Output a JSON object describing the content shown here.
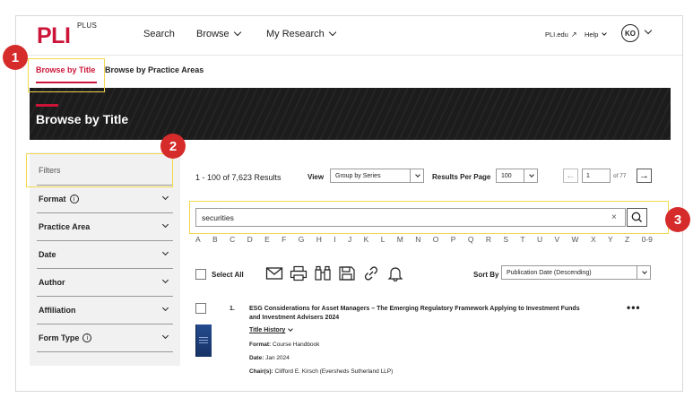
{
  "header": {
    "logo": "PLI",
    "logo_sup": "PLUS",
    "nav": {
      "search": "Search",
      "browse": "Browse",
      "my_research": "My Research"
    },
    "pli_edu": "PLI.edu",
    "help": "Help",
    "avatar_initials": "KO"
  },
  "subtabs": {
    "browse_by_title": "Browse by Title",
    "browse_by_practice_areas": "Browse by Practice Areas"
  },
  "banner": {
    "title": "Browse by Title"
  },
  "sidebar": {
    "filters_label": "Filters",
    "items": [
      {
        "label": "Format",
        "info": true
      },
      {
        "label": "Practice Area",
        "info": false
      },
      {
        "label": "Date",
        "info": false
      },
      {
        "label": "Author",
        "info": false
      },
      {
        "label": "Affiliation",
        "info": false
      },
      {
        "label": "Form Type",
        "info": true
      }
    ]
  },
  "results": {
    "count_text": "1 - 100 of 7,623 Results",
    "view_label": "View",
    "view_value": "Group by Series",
    "per_page_label": "Results Per Page",
    "per_page_value": "100",
    "page_value": "1",
    "page_of": "of 77"
  },
  "search": {
    "value": "securities",
    "clear": "×"
  },
  "alphabet": [
    "A",
    "B",
    "C",
    "D",
    "E",
    "F",
    "G",
    "H",
    "I",
    "J",
    "K",
    "L",
    "M",
    "N",
    "O",
    "P",
    "Q",
    "R",
    "S",
    "T",
    "U",
    "V",
    "W",
    "X",
    "Y",
    "Z",
    "0-9"
  ],
  "toolbar": {
    "select_all": "Select All",
    "sort_by_label": "Sort By",
    "sort_by_value": "Publication Date (Descending)"
  },
  "result_item": {
    "number": "1.",
    "title": "ESG Considerations for Asset Managers – The Emerging Regulatory Framework Applying to Investment Funds and Investment Advisers 2024",
    "title_history": "Title History",
    "format_label": "Format:",
    "format_value": "Course Handbook",
    "date_label": "Date:",
    "date_value": "Jan 2024",
    "chairs_label": "Chair(s):",
    "chairs_value": "Clifford E. Kirsch (Eversheds Sutherland LLP)",
    "more": "•••"
  },
  "annotations": {
    "badge_1": "1",
    "badge_2": "2",
    "badge_3": "3"
  },
  "colors": {
    "brand_red": "#cc1438",
    "highlight": "#f2d74e",
    "badge_red": "#d62b2b"
  },
  "icons": [
    "email-icon",
    "print-icon",
    "binoculars-icon",
    "save-icon",
    "link-icon",
    "bell-icon",
    "search-icon",
    "info-icon",
    "arrow-left-icon",
    "arrow-right-icon",
    "chevron-down-icon",
    "external-link-icon"
  ]
}
